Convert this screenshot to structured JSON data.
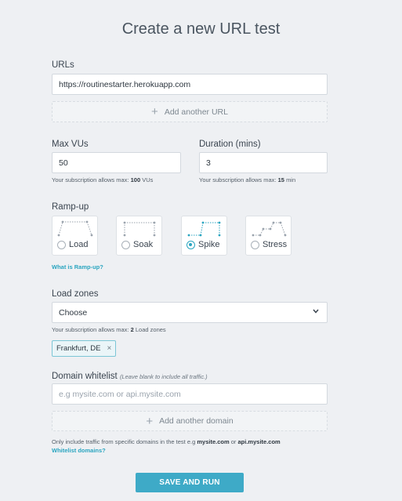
{
  "page": {
    "title": "Create a new URL test"
  },
  "urls": {
    "label": "URLs",
    "value": "https://routinestarter.herokuapp.com",
    "add_label": "Add another URL"
  },
  "max_vus": {
    "label": "Max VUs",
    "value": "50",
    "hint_prefix": "Your subscription allows max:",
    "hint_value": "100",
    "hint_suffix": "VUs"
  },
  "duration": {
    "label": "Duration (mins)",
    "value": "3",
    "hint_prefix": "Your subscription allows max:",
    "hint_value": "15",
    "hint_suffix": "min"
  },
  "rampup": {
    "label": "Ramp-up",
    "options": [
      {
        "label": "Load",
        "selected": false
      },
      {
        "label": "Soak",
        "selected": false
      },
      {
        "label": "Spike",
        "selected": true
      },
      {
        "label": "Stress",
        "selected": false
      }
    ],
    "help_link": "What is Ramp-up?"
  },
  "load_zones": {
    "label": "Load zones",
    "select_value": "Choose",
    "hint_prefix": "Your subscription allows max:",
    "hint_value": "2",
    "hint_suffix": "Load zones",
    "chips": [
      {
        "label": "Frankfurt, DE"
      }
    ],
    "remove_glyph": "×"
  },
  "domain_whitelist": {
    "label": "Domain whitelist",
    "note": "(Leave blank to include all traffic.)",
    "placeholder": "e.g mysite.com or api.mysite.com",
    "add_label": "Add another domain",
    "info_prefix": "Only include traffic from specific domains in the test e.g",
    "info_example1": "mysite.com",
    "info_or": "or",
    "info_example2": "api.mysite.com",
    "help_link": "Whitelist domains?"
  },
  "submit": {
    "label": "SAVE AND RUN"
  },
  "icons": {
    "plus": "plus-icon",
    "chevron": "chevron-down-icon",
    "remove": "close-icon"
  },
  "colors": {
    "accent": "#3eaac7",
    "link": "#2aa5c0",
    "background": "#eef0f3"
  }
}
